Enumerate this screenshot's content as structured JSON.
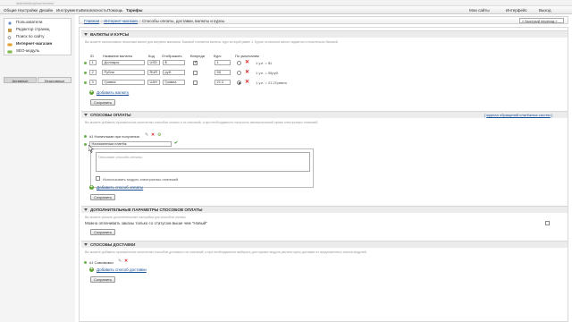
{
  "browser": {
    "url": "/admin/shop/currencies/"
  },
  "topnav": {
    "items": [
      "Общие",
      "Настройки",
      "Дизайн",
      "Инструменты",
      "Безопасность",
      "Помощь",
      "Тарифы"
    ],
    "right": [
      "Мои сайты",
      "Интерфейс",
      "Выход"
    ]
  },
  "sidebar": {
    "items": [
      "Пользователи",
      "Редактор страниц",
      "Поиск по сайту",
      "Интернет-магазин",
      "SEO-модуль"
    ],
    "tabs": [
      "Активные",
      "Неактивные"
    ]
  },
  "breadcrumb": {
    "home": "Главная",
    "shop": "Интернет-магазин",
    "current": "Способы оплаты, доставки, валюты и курсы",
    "sep": "»"
  },
  "quick_nav": {
    "value": "« Быстрый переход »"
  },
  "currencies": {
    "title": "ВАЛЮТЫ И КУРСЫ",
    "hint": "Вы можете использовать несколько валют для витрины магазина. Базовой считается валюта, курс которой равен 1. Курсы остальных валют задаются относительно базовой.",
    "headers": {
      "id": "ID",
      "name": "Название валюты",
      "code": "Код",
      "display": "Отображать",
      "first": "Впереди",
      "rate": "Курс",
      "default": "По умолчанию"
    },
    "rows": [
      {
        "id": "1",
        "name": "Доллары",
        "code": "USD",
        "display": "$",
        "first": true,
        "rate": "1",
        "is_default": false,
        "note": "1 у.е. = $1"
      },
      {
        "id": "2",
        "name": "Рубли",
        "code": "RUR",
        "display": "руб.",
        "first": false,
        "rate": "55",
        "is_default": false,
        "note": "1 у.е. = 55руб."
      },
      {
        "id": "3",
        "name": "Гривна",
        "code": "UAH",
        "display": "Гривна",
        "first": false,
        "rate": "21.2",
        "is_default": true,
        "note": "1 у.е. = 21.2Гривна"
      }
    ],
    "add_label": "Добавить валюту",
    "save_label": "Сохранить"
  },
  "payments": {
    "title": "СПОСОБЫ ОПЛАТЫ",
    "log_link": "журнал обращений платёжных систем",
    "hint": "Вы можете добавить произвольное количество способов оплаты и их описаний, а при необходимости настроить автоматический прием электронных платежей.",
    "items": [
      {
        "label": "#1 Наличными при получении"
      }
    ],
    "edit_name": "Наложенным платёж",
    "desc_placeholder": "Описание способа оплаты",
    "use_module_label": "Использовать модуль электронных платежей",
    "add_label": "Добавить способ оплаты",
    "save_label": "Сохранить"
  },
  "extra_params": {
    "title": "ДОПОЛНИТЕЛЬНЫЕ ПАРАМЕТРЫ СПОСОБОВ ОПЛАТЫ",
    "hint": "Вы можете указать дополнительные настройки для способов оплаты.",
    "option_label": "Можно оплачивать заказы только со статусом выше чем \"Новый\"",
    "save_label": "Сохранить"
  },
  "delivery": {
    "title": "СПОСОБЫ ДОСТАВКИ",
    "hint": "Вы можете добавить произвольное количество способов доставки и их описаний, а при необходимости выбирать для нужных модуль расчета цены доставки из предложенного списка модулей.",
    "items": [
      {
        "label": "#1 Самовывоз"
      }
    ],
    "add_label": "Добавить способ доставки",
    "save_label": "Сохранить"
  },
  "colors": {
    "accent_link": "#1a4f9a",
    "delete": "#dd2222",
    "ok": "#5aa02c"
  }
}
